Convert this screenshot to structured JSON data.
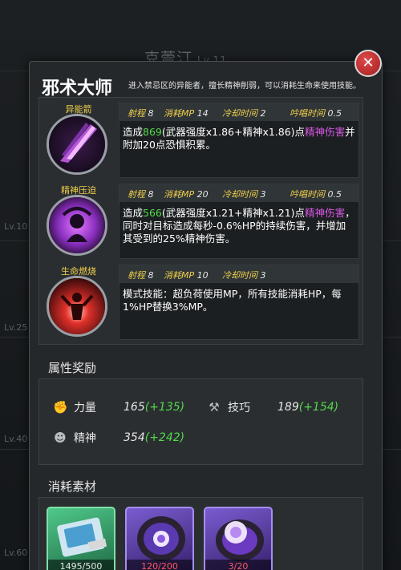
{
  "background": {
    "title": "克蕾汀",
    "title_level": "Lv.11",
    "levels": [
      "Lv.10",
      "Lv.25",
      "Lv.40",
      "Lv.60"
    ]
  },
  "header": {
    "title": "邪术大师",
    "description": "进入禁忌区的异能者，擅长精神削弱，可以消耗生命来使用技能。"
  },
  "skills": [
    {
      "name": "异能箭",
      "icon": "purple-arrow-icon",
      "range_label": "射程",
      "range": "8",
      "mp_label": "消耗MP",
      "mp": "14",
      "cd_label": "冷却时间",
      "cd": "2",
      "cast_label": "吟唱时间",
      "cast": "0.5",
      "desc_a": "造成",
      "desc_num": "869",
      "desc_b": "(武器强度x1.86+精神x1.86)点",
      "desc_type": "精神伤害",
      "desc_c": "并附加20点恐惧积累。"
    },
    {
      "name": "精神压迫",
      "icon": "mind-press-icon",
      "range_label": "射程",
      "range": "8",
      "mp_label": "消耗MP",
      "mp": "20",
      "cd_label": "冷却时间",
      "cd": "3",
      "cast_label": "吟唱时间",
      "cast": "0.5",
      "desc_a": "造成",
      "desc_num": "566",
      "desc_b": "(武器强度x1.21+精神x1.21)点",
      "desc_type": "精神伤害",
      "desc_c": "，同时对目标造成每秒-0.6%HP的持续伤害，并增加其受到的25%精神伤害。"
    },
    {
      "name": "生命燃烧",
      "icon": "life-burn-icon",
      "range_label": "射程",
      "range": "8",
      "mp_label": "消耗MP",
      "mp": "10",
      "cd_label": "冷却时间",
      "cd": "3",
      "desc_full": "模式技能：超负荷使用MP，所有技能消耗HP，每1%HP替换3%MP。"
    }
  ],
  "attributes": {
    "title": "属性奖励",
    "items": [
      {
        "icon": "fist-icon",
        "name": "力量",
        "value": "165",
        "bonus": "(+135)"
      },
      {
        "icon": "tools-icon",
        "name": "技巧",
        "value": "189",
        "bonus": "(+154)"
      },
      {
        "icon": "head-icon",
        "name": "精神",
        "value": "354",
        "bonus": "(+242)"
      }
    ]
  },
  "materials": {
    "title": "消耗素材",
    "items": [
      {
        "icon": "card-chip-icon",
        "count": "1495/500",
        "color": "#3fa56a"
      },
      {
        "icon": "purple-core-icon",
        "count": "120/200",
        "color": "#6a4fb5"
      },
      {
        "icon": "glow-core-icon",
        "count": "3/20",
        "color": "#6a4fb5"
      }
    ]
  }
}
